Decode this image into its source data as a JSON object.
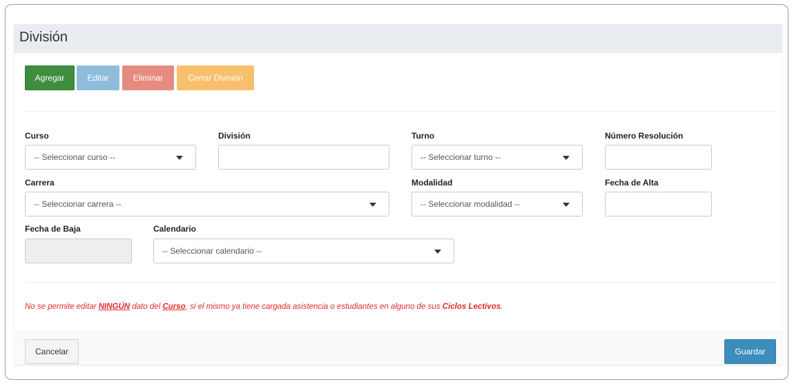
{
  "panel": {
    "title": "División"
  },
  "toolbar": {
    "add_label": "Agregar",
    "edit_label": "Editar",
    "delete_label": "Eliminar",
    "close_label": "Cerrar División"
  },
  "form": {
    "curso": {
      "label": "Curso",
      "placeholder": "-- Seleccionar curso --"
    },
    "division": {
      "label": "División",
      "value": ""
    },
    "turno": {
      "label": "Turno",
      "placeholder": "-- Seleccionar turno --"
    },
    "numero_resolucion": {
      "label": "Número Resolución",
      "value": ""
    },
    "carrera": {
      "label": "Carrera",
      "placeholder": "-- Seleccionar carrera --"
    },
    "modalidad": {
      "label": "Modalidad",
      "placeholder": "-- Seleccionar modalidad --"
    },
    "fecha_alta": {
      "label": "Fecha de Alta",
      "value": ""
    },
    "fecha_baja": {
      "label": "Fecha de Baja",
      "value": ""
    },
    "calendario": {
      "label": "Calendario",
      "placeholder": "-- Seleccionar calendario --"
    }
  },
  "notice": {
    "part1": "No se permite editar ",
    "ningun": "NINGÚN",
    "part2": " dato del ",
    "curso": "Curso",
    "part3": ", si el mismo ya tiene cargada asistencia o estudiantes en alguno de sus ",
    "ciclos": "Ciclos Lectivos",
    "part4": "."
  },
  "footer": {
    "cancel_label": "Cancelar",
    "save_label": "Guardar"
  },
  "colors": {
    "add": "#3f8e3f",
    "edit": "#8fbcdb",
    "delete": "#e58b80",
    "close": "#f8c06c",
    "save": "#3c8dbc",
    "notice": "#e22b2b"
  }
}
